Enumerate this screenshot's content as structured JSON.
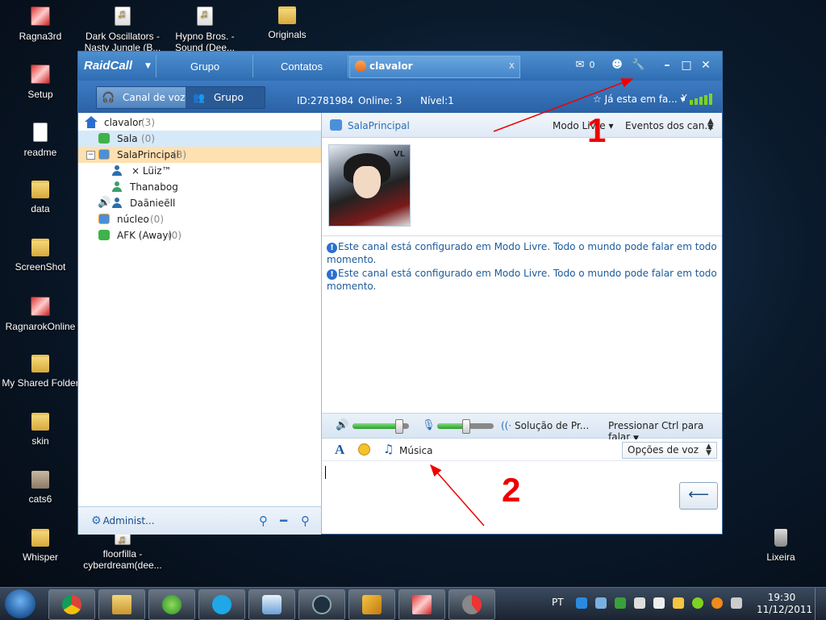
{
  "desktop": {
    "icons": [
      {
        "label": "Ragna3rd"
      },
      {
        "label": "Setup"
      },
      {
        "label": "readme"
      },
      {
        "label": "data"
      },
      {
        "label": "ScreenShot"
      },
      {
        "label": "RagnarokOnline"
      },
      {
        "label": "My Shared Folder"
      },
      {
        "label": "skin"
      },
      {
        "label": "cats6"
      },
      {
        "label": "Whisper"
      },
      {
        "label": "Dark Oscillators - Nasty Jungle (B..."
      },
      {
        "label": "Hypno Bros. - Sound (Dee..."
      },
      {
        "label": "Originals"
      },
      {
        "label": "floorfilla - cyberdream(dee..."
      },
      {
        "label": "Lixeira"
      }
    ]
  },
  "window": {
    "logo": "RaidCall",
    "tabs": [
      "Grupo",
      "Contatos"
    ],
    "chat_tab": {
      "label": "clavalor",
      "close": "x"
    },
    "mail_count": "0",
    "toolbar": {
      "voice_channel": "Canal de voz",
      "group": "Grupo",
      "id": "ID:2781984",
      "online": "Online: 3",
      "level": "Nível:1",
      "favorite": "Já esta em fa..."
    }
  },
  "tree": {
    "root": {
      "name": "clavalor",
      "count": "(3)"
    },
    "items": [
      {
        "name": "Sala",
        "count": "(0)"
      },
      {
        "name": "SalaPrincipal",
        "count": "(3)"
      },
      {
        "name": "× Lüiz™"
      },
      {
        "name": "Thanabog"
      },
      {
        "name": "Daãnieẽll"
      },
      {
        "name": "núcleo",
        "count": "(0)"
      },
      {
        "name": "AFK (Away)",
        "count": "(0)"
      }
    ],
    "footer": {
      "admin": "Administ..."
    }
  },
  "channel": {
    "name": "SalaPrincipal",
    "mode": "Modo Livre",
    "events": "Eventos dos can...",
    "avatar_badge": "VL"
  },
  "messages": [
    {
      "text": "Este canal está configurado em Modo Livre. Todo o mundo pode falar em todo momento."
    },
    {
      "text": "Este canal está configurado em Modo Livre. Todo o mundo pode falar em todo momento."
    }
  ],
  "voice": {
    "output_level": 0.82,
    "input_level": 0.5,
    "solution": "Solução de Pr...",
    "ptt": "Pressionar Ctrl para falar"
  },
  "chat_tools": {
    "music": "Música",
    "voice_options": "Opções de voz"
  },
  "annotations": {
    "one": "1",
    "two": "2"
  },
  "taskbar": {
    "lang": "PT",
    "time": "19:30",
    "date": "11/12/2011"
  },
  "colors": {
    "titlebar": "#2f6db2",
    "selected_row": "#ffe0b0",
    "hover_row": "#d6e9f8",
    "annotation": "#e00000"
  }
}
